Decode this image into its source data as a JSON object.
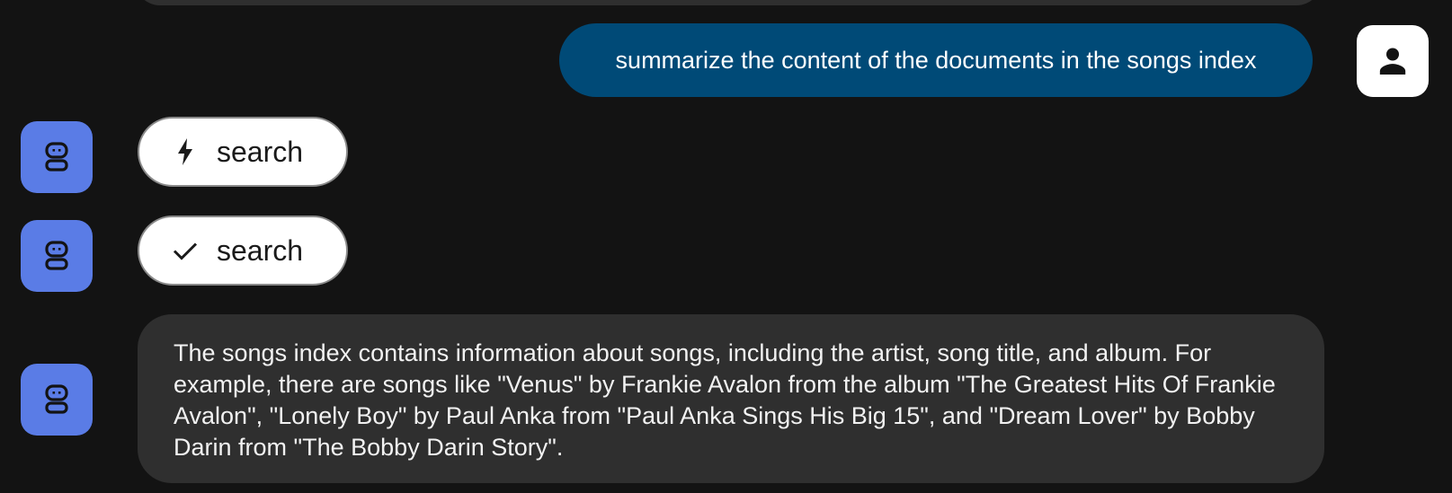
{
  "conversation": {
    "user_message": {
      "text": "summarize the content of the documents in the songs index",
      "avatar_icon": "person-icon",
      "bubble_color": "#004a77"
    },
    "tool_calls": [
      {
        "status": "running",
        "status_icon": "bolt-icon",
        "label": "search"
      },
      {
        "status": "done",
        "status_icon": "check-icon",
        "label": "search"
      }
    ],
    "assistant_message": {
      "text": "The songs index contains information about songs, including the artist, song title, and album. For example, there are songs like \"Venus\" by Frankie Avalon from the album \"The Greatest Hits Of Frankie Avalon\", \"Lonely Boy\" by Paul Anka from \"Paul Anka Sings His Big 15\", and \"Dream Lover\" by Bobby Darin from \"The Bobby Darin Story\".",
      "avatar_icon": "robot-icon",
      "avatar_color": "#5a7ce6"
    }
  }
}
